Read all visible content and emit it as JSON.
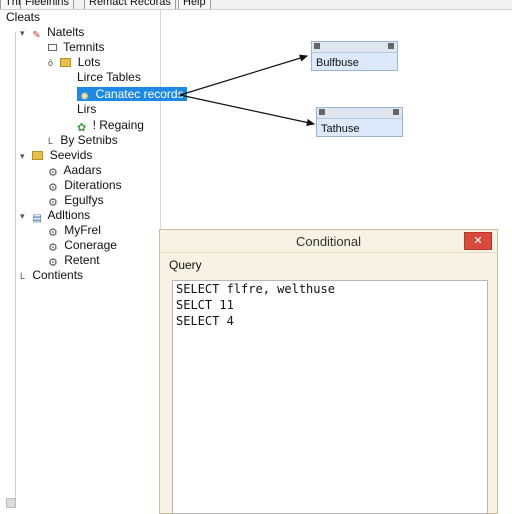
{
  "menu": {
    "items": [
      "ThE",
      "Fieelnins",
      "Remact Recoras",
      "Help"
    ]
  },
  "tree": {
    "nodes": [
      {
        "label": "Cleats"
      },
      {
        "label": "Natelts"
      },
      {
        "label": "Temnits"
      },
      {
        "label": "Lots"
      },
      {
        "label": "Lirce Tables"
      },
      {
        "label": "Canatec records"
      },
      {
        "label": "Lirs"
      },
      {
        "label": "! Regaing"
      },
      {
        "label": "By Setnibs"
      },
      {
        "label": "Seevids"
      },
      {
        "label": "Aadars"
      },
      {
        "label": "Diterations"
      },
      {
        "label": "Egulfys"
      },
      {
        "label": "Adltions"
      },
      {
        "label": "MyFrel"
      },
      {
        "label": "Conerage"
      },
      {
        "label": "Retent"
      },
      {
        "label": "Contients"
      }
    ]
  },
  "diagram": {
    "entities": [
      {
        "name": "Bulfbuse"
      },
      {
        "name": "Tathuse"
      }
    ]
  },
  "dialog": {
    "title": "Conditional",
    "close_label": "✕",
    "query_label": "Query",
    "query_lines": [
      "SELECT flfre, welthuse",
      "SELCT 11",
      "SELECT 4"
    ]
  }
}
